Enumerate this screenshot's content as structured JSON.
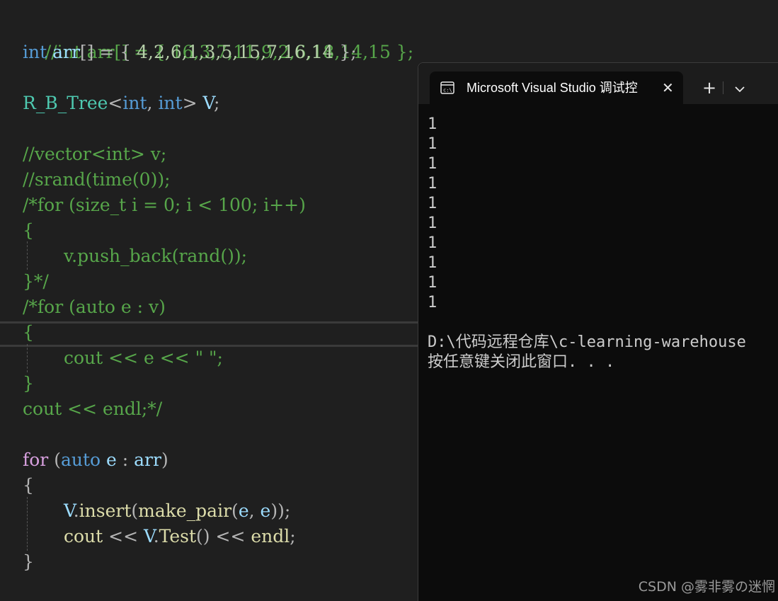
{
  "editor": {
    "lines": {
      "l0": [
        "//int arr[] = { 16,3,7,11,9,2,6,18,14,15 };"
      ],
      "l1": [
        "int",
        " ",
        "arr",
        "[] = { ",
        "4,2,6,1,3,5,15,7,16,14",
        " };"
      ],
      "l3": [
        "R_B_Tree",
        "<",
        "int",
        ", ",
        "int",
        "> ",
        "V",
        ";"
      ],
      "l5": [
        "//vector<int> v;"
      ],
      "l6": [
        "//srand(time(0));"
      ],
      "l7": [
        "/*for (size_t i = 0; i < 100; i++)"
      ],
      "l8": [
        "{"
      ],
      "l9": [
        "v.push_back(rand());"
      ],
      "l10": [
        "}*/"
      ],
      "l11": [
        "/*for (auto e : v)"
      ],
      "l12": [
        "{"
      ],
      "l13": [
        "cout << e << \" \";"
      ],
      "l14": [
        "}"
      ],
      "l15": [
        "cout << endl;*/"
      ],
      "l17": [
        "for",
        " (",
        "auto",
        " ",
        "e",
        " : ",
        "arr",
        ")"
      ],
      "l18": [
        "{"
      ],
      "l19": [
        "V",
        ".",
        "insert",
        "(",
        "make_pair",
        "(",
        "e",
        ", ",
        "e",
        "));"
      ],
      "l20": [
        "cout",
        " << ",
        "V",
        ".",
        "Test",
        "() << ",
        "endl",
        ";"
      ],
      "l21": [
        "}"
      ]
    }
  },
  "terminal": {
    "tab_title": "Microsoft Visual Studio 调试控",
    "tab_icon": "console-window-icon",
    "close_glyph": "✕",
    "new_tab_glyph": "+",
    "dropdown_icon": "chevron-down-icon",
    "output": [
      "1",
      "1",
      "1",
      "1",
      "1",
      "1",
      "1",
      "1",
      "1",
      "1"
    ],
    "path_line": "D:\\代码远程仓库\\c-learning-warehouse",
    "prompt_line": "按任意键关闭此窗口. . ."
  },
  "watermark": "CSDN @雾非雾の迷惘",
  "colors": {
    "editor_bg": "#1f1f1f",
    "terminal_bg": "#0c0c0c",
    "comment": "#57a64a",
    "keyword": "#569cd6",
    "control_keyword": "#d8a0df",
    "type": "#4ec9b0",
    "variable": "#9cdcfe",
    "function": "#dcdcaa",
    "number": "#b5cea8"
  }
}
